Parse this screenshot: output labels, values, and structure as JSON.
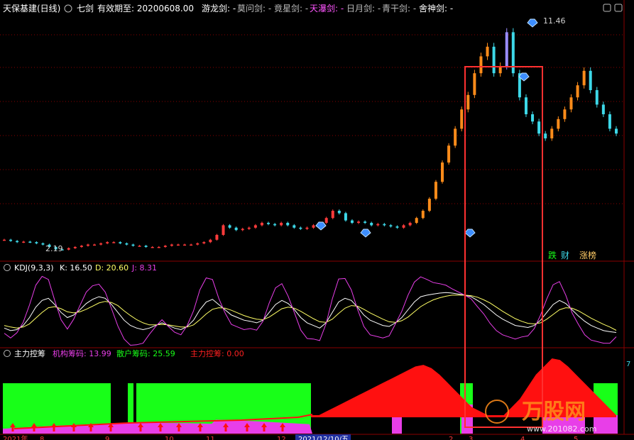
{
  "colors": {
    "up": "#ff3b3b",
    "down": "#3dd8e8",
    "orange": "#ff8c1a",
    "grid": "#8a0000",
    "magenta": "#e83ee8",
    "green": "#18ff18",
    "red": "#ff1010",
    "white": "#ffffff",
    "yellow": "#ffff66",
    "violet": "#9a8cff"
  },
  "header": {
    "stock": "天保基建(日线)",
    "indicator": "七剑",
    "valid_label": "有效期至: 20200608.00",
    "swords": [
      {
        "text": "游龙剑: -",
        "color": "#ffffff"
      },
      {
        "text": "莫问剑: -",
        "color": "#bbbbbb"
      },
      {
        "text": "竟星剑: -",
        "color": "#bbbbbb"
      },
      {
        "text": "天瀑剑: -",
        "color": "#ff55ff"
      },
      {
        "text": "日月剑: -",
        "color": "#bbbbbb"
      },
      {
        "text": "青干剑: -",
        "color": "#bbbbbb"
      },
      {
        "text": "舍神剑: -",
        "color": "#ffffff"
      }
    ],
    "high_label": "11.46",
    "low_label": "2.19",
    "tag_die": "跌",
    "tag_cai": "财",
    "tag_zhangbang": "涨榜"
  },
  "kdj": {
    "name": "KDJ(9,3,3)",
    "k_label": "K: 16.50",
    "d_label": "D: 20.60",
    "j_label": "J: 8.31"
  },
  "chips": {
    "name": "主力控筹",
    "inst_label": "机构筹码: 13.99",
    "retail_label": "散户筹码: 25.59",
    "main_label": "主力控筹: 0.00",
    "right_value": "7"
  },
  "xaxis": {
    "labels": [
      "2021年",
      "8",
      "9",
      "10",
      "11",
      "12",
      "2021/12/10/五",
      "2",
      "3",
      "4",
      "5"
    ]
  },
  "watermark": {
    "brand": "万股网",
    "url": "www.201082.com"
  },
  "chart_data": [
    {
      "type": "candlestick",
      "title": "",
      "annotations": [
        {
          "label": "11.46",
          "kind": "high"
        },
        {
          "label": "2.19",
          "kind": "low"
        }
      ],
      "x": [
        "2021年",
        "8",
        "9",
        "10",
        "11",
        "12",
        "2021/12/10/五",
        "2",
        "3",
        "4",
        "5"
      ],
      "series": [
        {
          "values": [
            2.6,
            2.55,
            2.5,
            2.52,
            2.5,
            2.45,
            2.4,
            2.3,
            2.2,
            2.19,
            2.25,
            2.3,
            2.35,
            2.4,
            2.4,
            2.45,
            2.5,
            2.5,
            2.45,
            2.4,
            2.35,
            2.35,
            2.3,
            2.3,
            2.3,
            2.35,
            2.4,
            2.4,
            2.4,
            2.4,
            2.45,
            2.5,
            2.6,
            2.8,
            3.2,
            3.1,
            3.0,
            3.05,
            3.1,
            3.2,
            3.3,
            3.25,
            3.2,
            3.3,
            3.2,
            3.1,
            3.05,
            3.1,
            3.2,
            3.3,
            3.5,
            3.8,
            3.7,
            3.4,
            3.3,
            3.35,
            3.3,
            3.2,
            3.25,
            3.2,
            3.15,
            3.1,
            3.2,
            3.3,
            3.5,
            3.8,
            4.3,
            5.0,
            5.8,
            6.5,
            7.2,
            8.0,
            8.6,
            9.5,
            10.2,
            10.6,
            9.5,
            9.8,
            11.2,
            9.5,
            8.5,
            7.8,
            7.5,
            7.0,
            6.8,
            7.2,
            7.6,
            8.0,
            8.5,
            9.0,
            9.6,
            8.8,
            8.2,
            7.8,
            7.2,
            7.0
          ]
        }
      ]
    },
    {
      "type": "line",
      "title": "KDJ(9,3,3)",
      "x": [
        "2021年",
        "8",
        "9",
        "10",
        "11",
        "12",
        "2021/12/10/五",
        "2",
        "3",
        "4",
        "5"
      ],
      "series": [
        {
          "name": "K",
          "values": [
            25,
            20,
            22,
            30,
            45,
            65,
            78,
            82,
            70,
            55,
            45,
            50,
            60,
            72,
            80,
            85,
            82,
            70,
            55,
            40,
            30,
            25,
            22,
            25,
            30,
            35,
            30,
            25,
            22,
            28,
            40,
            60,
            75,
            80,
            70,
            60,
            50,
            45,
            40,
            38,
            35,
            40,
            55,
            70,
            78,
            72,
            60,
            45,
            35,
            30,
            25,
            35,
            55,
            75,
            82,
            78,
            65,
            50,
            40,
            35,
            30,
            28,
            35,
            45,
            60,
            75,
            85,
            88,
            90,
            92,
            93,
            92,
            90,
            88,
            85,
            78,
            70,
            60,
            50,
            42,
            36,
            30,
            28,
            26,
            30,
            40,
            55,
            70,
            78,
            72,
            60,
            48,
            38,
            30,
            25,
            20,
            18,
            16.5
          ]
        },
        {
          "name": "D",
          "values": [
            30,
            27,
            25,
            27,
            33,
            44,
            55,
            64,
            66,
            62,
            56,
            54,
            56,
            61,
            67,
            73,
            76,
            74,
            68,
            58,
            49,
            41,
            35,
            31,
            31,
            32,
            31,
            29,
            27,
            27,
            31,
            41,
            52,
            61,
            64,
            63,
            59,
            54,
            49,
            45,
            42,
            41,
            46,
            54,
            62,
            65,
            63,
            57,
            50,
            43,
            37,
            36,
            42,
            53,
            63,
            68,
            67,
            61,
            54,
            48,
            42,
            37,
            36,
            39,
            46,
            56,
            66,
            73,
            79,
            83,
            86,
            88,
            88,
            88,
            87,
            84,
            79,
            73,
            65,
            57,
            50,
            43,
            38,
            34,
            33,
            35,
            42,
            51,
            60,
            64,
            63,
            58,
            51,
            44,
            38,
            32,
            27,
            20.6
          ]
        },
        {
          "name": "J",
          "values": [
            15,
            6,
            16,
            36,
            69,
            107,
            124,
            118,
            78,
            41,
            23,
            42,
            68,
            94,
            106,
            109,
            94,
            62,
            29,
            4,
            -8,
            -7,
            -4,
            13,
            28,
            41,
            28,
            17,
            12,
            30,
            58,
            98,
            121,
            118,
            82,
            54,
            32,
            27,
            22,
            24,
            21,
            38,
            73,
            102,
            110,
            86,
            54,
            21,
            5,
            4,
            1,
            33,
            81,
            119,
            120,
            98,
            61,
            28,
            12,
            9,
            6,
            10,
            33,
            57,
            88,
            113,
            123,
            118,
            112,
            110,
            107,
            100,
            94,
            88,
            81,
            66,
            52,
            34,
            20,
            12,
            8,
            4,
            8,
            10,
            24,
            50,
            81,
            108,
            114,
            88,
            54,
            32,
            12,
            2,
            -1,
            -4,
            -4,
            8.31
          ]
        }
      ]
    },
    {
      "type": "area",
      "title": "主力控筹",
      "x": [
        "2021年",
        "8",
        "9",
        "10",
        "11",
        "12",
        "2021/12/10/五",
        "2",
        "3",
        "4",
        "5"
      ],
      "series": [
        {
          "name": "机构筹码",
          "values": [
            13,
            12,
            12,
            13,
            14,
            15,
            16,
            17,
            17,
            16,
            15,
            15,
            16,
            17,
            18,
            19,
            20,
            21,
            22,
            22,
            22,
            22,
            21,
            20,
            19,
            18,
            17,
            16,
            15,
            15,
            14,
            14,
            13,
            13,
            13,
            14,
            14,
            14,
            13.99
          ]
        },
        {
          "name": "散户筹码",
          "values": [
            40,
            38,
            36,
            35,
            34,
            33,
            32,
            31,
            30,
            29,
            29,
            30,
            31,
            32,
            33,
            34,
            35,
            35,
            34,
            33,
            32,
            31,
            30,
            29,
            28,
            27,
            27,
            26,
            26,
            26,
            25.59
          ]
        },
        {
          "name": "主力控筹",
          "values": [
            0,
            0,
            5,
            10,
            15,
            20,
            25,
            30,
            35,
            40,
            45,
            50,
            55,
            60,
            62,
            58,
            50,
            40,
            30,
            20,
            10,
            5,
            0,
            0,
            0,
            10,
            20,
            35,
            50,
            60,
            70,
            68,
            60,
            50,
            40,
            30,
            20,
            10,
            0.0
          ]
        }
      ]
    }
  ]
}
